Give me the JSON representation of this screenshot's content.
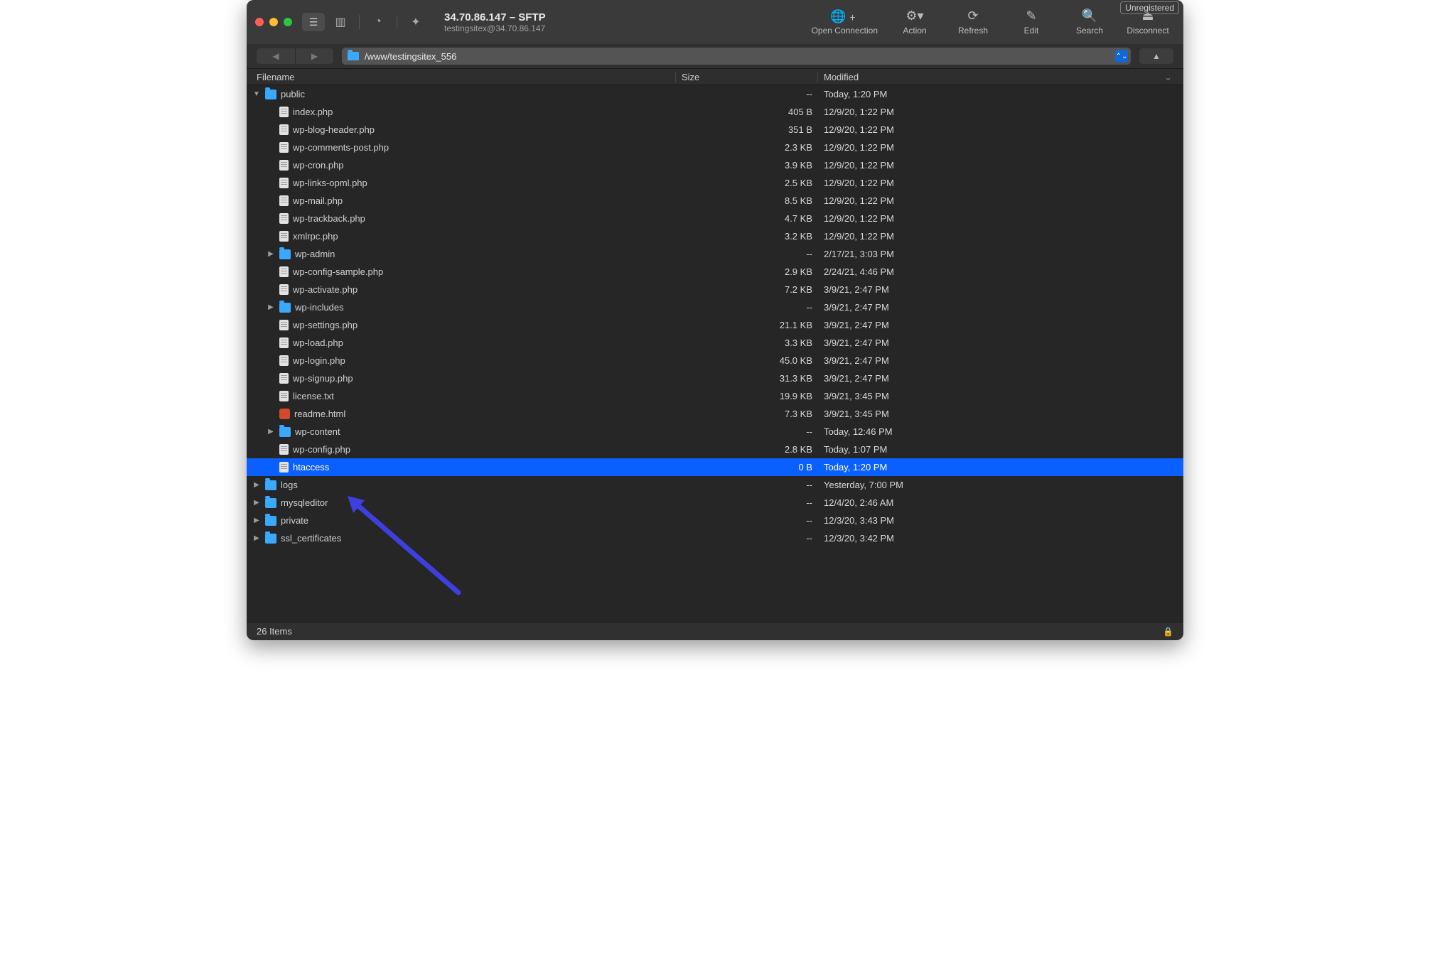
{
  "window": {
    "title": "34.70.86.147 – SFTP",
    "subtitle": "testingsitex@34.70.86.147",
    "unregistered": "Unregistered"
  },
  "toolbar": {
    "open_connection": "Open Connection",
    "action": "Action",
    "refresh": "Refresh",
    "edit": "Edit",
    "search": "Search",
    "disconnect": "Disconnect"
  },
  "path": "/www/testingsitex_556",
  "columns": {
    "filename": "Filename",
    "size": "Size",
    "modified": "Modified"
  },
  "files": [
    {
      "indent": 0,
      "expand": "down",
      "type": "folder",
      "name": "public",
      "size": "--",
      "modified": "Today, 1:20 PM"
    },
    {
      "indent": 1,
      "expand": "",
      "type": "file",
      "name": "index.php",
      "size": "405 B",
      "modified": "12/9/20, 1:22 PM"
    },
    {
      "indent": 1,
      "expand": "",
      "type": "file",
      "name": "wp-blog-header.php",
      "size": "351 B",
      "modified": "12/9/20, 1:22 PM"
    },
    {
      "indent": 1,
      "expand": "",
      "type": "file",
      "name": "wp-comments-post.php",
      "size": "2.3 KB",
      "modified": "12/9/20, 1:22 PM"
    },
    {
      "indent": 1,
      "expand": "",
      "type": "file",
      "name": "wp-cron.php",
      "size": "3.9 KB",
      "modified": "12/9/20, 1:22 PM"
    },
    {
      "indent": 1,
      "expand": "",
      "type": "file",
      "name": "wp-links-opml.php",
      "size": "2.5 KB",
      "modified": "12/9/20, 1:22 PM"
    },
    {
      "indent": 1,
      "expand": "",
      "type": "file",
      "name": "wp-mail.php",
      "size": "8.5 KB",
      "modified": "12/9/20, 1:22 PM"
    },
    {
      "indent": 1,
      "expand": "",
      "type": "file",
      "name": "wp-trackback.php",
      "size": "4.7 KB",
      "modified": "12/9/20, 1:22 PM"
    },
    {
      "indent": 1,
      "expand": "",
      "type": "file",
      "name": "xmlrpc.php",
      "size": "3.2 KB",
      "modified": "12/9/20, 1:22 PM"
    },
    {
      "indent": 1,
      "expand": "right",
      "type": "folder",
      "name": "wp-admin",
      "size": "--",
      "modified": "2/17/21, 3:03 PM"
    },
    {
      "indent": 1,
      "expand": "",
      "type": "file",
      "name": "wp-config-sample.php",
      "size": "2.9 KB",
      "modified": "2/24/21, 4:46 PM"
    },
    {
      "indent": 1,
      "expand": "",
      "type": "file",
      "name": "wp-activate.php",
      "size": "7.2 KB",
      "modified": "3/9/21, 2:47 PM"
    },
    {
      "indent": 1,
      "expand": "right",
      "type": "folder",
      "name": "wp-includes",
      "size": "--",
      "modified": "3/9/21, 2:47 PM"
    },
    {
      "indent": 1,
      "expand": "",
      "type": "file",
      "name": "wp-settings.php",
      "size": "21.1 KB",
      "modified": "3/9/21, 2:47 PM"
    },
    {
      "indent": 1,
      "expand": "",
      "type": "file",
      "name": "wp-load.php",
      "size": "3.3 KB",
      "modified": "3/9/21, 2:47 PM"
    },
    {
      "indent": 1,
      "expand": "",
      "type": "file",
      "name": "wp-login.php",
      "size": "45.0 KB",
      "modified": "3/9/21, 2:47 PM"
    },
    {
      "indent": 1,
      "expand": "",
      "type": "file",
      "name": "wp-signup.php",
      "size": "31.3 KB",
      "modified": "3/9/21, 2:47 PM"
    },
    {
      "indent": 1,
      "expand": "",
      "type": "file",
      "name": "license.txt",
      "size": "19.9 KB",
      "modified": "3/9/21, 3:45 PM"
    },
    {
      "indent": 1,
      "expand": "",
      "type": "html",
      "name": "readme.html",
      "size": "7.3 KB",
      "modified": "3/9/21, 3:45 PM"
    },
    {
      "indent": 1,
      "expand": "right",
      "type": "folder",
      "name": "wp-content",
      "size": "--",
      "modified": "Today, 12:46 PM"
    },
    {
      "indent": 1,
      "expand": "",
      "type": "file",
      "name": "wp-config.php",
      "size": "2.8 KB",
      "modified": "Today, 1:07 PM"
    },
    {
      "indent": 1,
      "expand": "",
      "type": "file",
      "name": "htaccess",
      "size": "0 B",
      "modified": "Today, 1:20 PM",
      "selected": true
    },
    {
      "indent": 0,
      "expand": "right",
      "type": "folder",
      "name": "logs",
      "size": "--",
      "modified": "Yesterday, 7:00 PM"
    },
    {
      "indent": 0,
      "expand": "right",
      "type": "folder",
      "name": "mysqleditor",
      "size": "--",
      "modified": "12/4/20, 2:46 AM"
    },
    {
      "indent": 0,
      "expand": "right",
      "type": "folder",
      "name": "private",
      "size": "--",
      "modified": "12/3/20, 3:43 PM"
    },
    {
      "indent": 0,
      "expand": "right",
      "type": "folder",
      "name": "ssl_certificates",
      "size": "--",
      "modified": "12/3/20, 3:42 PM"
    }
  ],
  "status": "26 Items"
}
